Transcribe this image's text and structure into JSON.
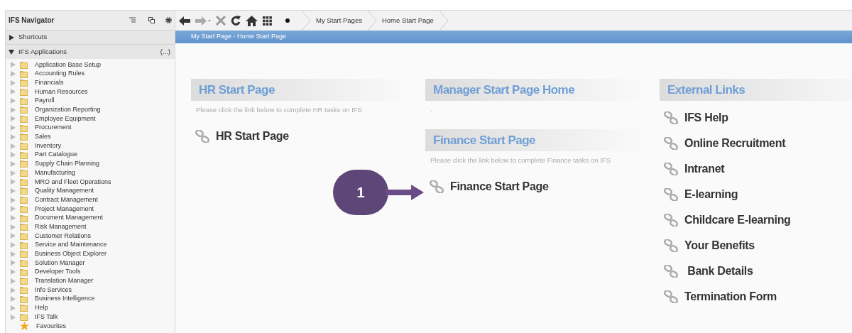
{
  "navigator": {
    "title": "IFS Navigator",
    "shortcuts": {
      "label": "Shortcuts",
      "expanded": false
    },
    "applications": {
      "label": "IFS Applications",
      "more": "(...)",
      "expanded": true,
      "items": [
        {
          "label": "Application Base Setup",
          "kind": "folder"
        },
        {
          "label": "Accounting Rules",
          "kind": "folder"
        },
        {
          "label": "Financials",
          "kind": "folder"
        },
        {
          "label": "Human Resources",
          "kind": "folder"
        },
        {
          "label": "Payroll",
          "kind": "folder"
        },
        {
          "label": "Organization Reporting",
          "kind": "folder"
        },
        {
          "label": "Employee Equipment",
          "kind": "folder"
        },
        {
          "label": "Procurement",
          "kind": "folder"
        },
        {
          "label": "Sales",
          "kind": "folder"
        },
        {
          "label": "Inventory",
          "kind": "folder"
        },
        {
          "label": "Part Catalogue",
          "kind": "folder"
        },
        {
          "label": "Supply Chain Planning",
          "kind": "folder"
        },
        {
          "label": "Manufacturing",
          "kind": "folder"
        },
        {
          "label": "MRO and Fleet Operations",
          "kind": "folder"
        },
        {
          "label": "Quality Management",
          "kind": "folder"
        },
        {
          "label": "Contract Management",
          "kind": "folder"
        },
        {
          "label": "Project Management",
          "kind": "folder"
        },
        {
          "label": "Document Management",
          "kind": "folder"
        },
        {
          "label": "Risk Management",
          "kind": "folder"
        },
        {
          "label": "Customer Relations",
          "kind": "folder"
        },
        {
          "label": "Service and Maintenance",
          "kind": "folder"
        },
        {
          "label": "Business Object Explorer",
          "kind": "folder"
        },
        {
          "label": "Solution Manager",
          "kind": "folder"
        },
        {
          "label": "Developer Tools",
          "kind": "folder"
        },
        {
          "label": "Translation Manager",
          "kind": "folder"
        },
        {
          "label": "Info Services",
          "kind": "folder"
        },
        {
          "label": "Business Intelligence",
          "kind": "folder"
        },
        {
          "label": "Help",
          "kind": "folder"
        },
        {
          "label": "IFS Talk",
          "kind": "folder"
        },
        {
          "label": "Favourites",
          "kind": "favourite"
        }
      ]
    }
  },
  "toolbar": {
    "breadcrumbs": [
      "My Start Pages",
      "Home Start Page"
    ]
  },
  "page_title": "My Start Page - Home Start Page",
  "columns": [
    {
      "sections": [
        {
          "title": "HR Start Page",
          "description": "Please click the link below to complete HR tasks on IFS",
          "links": [
            "HR Start Page"
          ]
        }
      ]
    },
    {
      "sections": [
        {
          "title": "Manager Start Page Home",
          "description": "."
        },
        {
          "title": "Finance Start Page",
          "description": "Please click the link below to complete Finance tasks on IFS",
          "links": [
            "Finance Start Page"
          ]
        }
      ]
    },
    {
      "sections": [
        {
          "title": "External Links",
          "links": [
            "IFS Help",
            "Online Recruitment",
            "Intranet",
            "E-learning",
            "Childcare E-learning",
            "Your Benefits",
            " Bank Details",
            "Termination Form"
          ]
        }
      ]
    }
  ],
  "annotation": {
    "label": "1"
  }
}
